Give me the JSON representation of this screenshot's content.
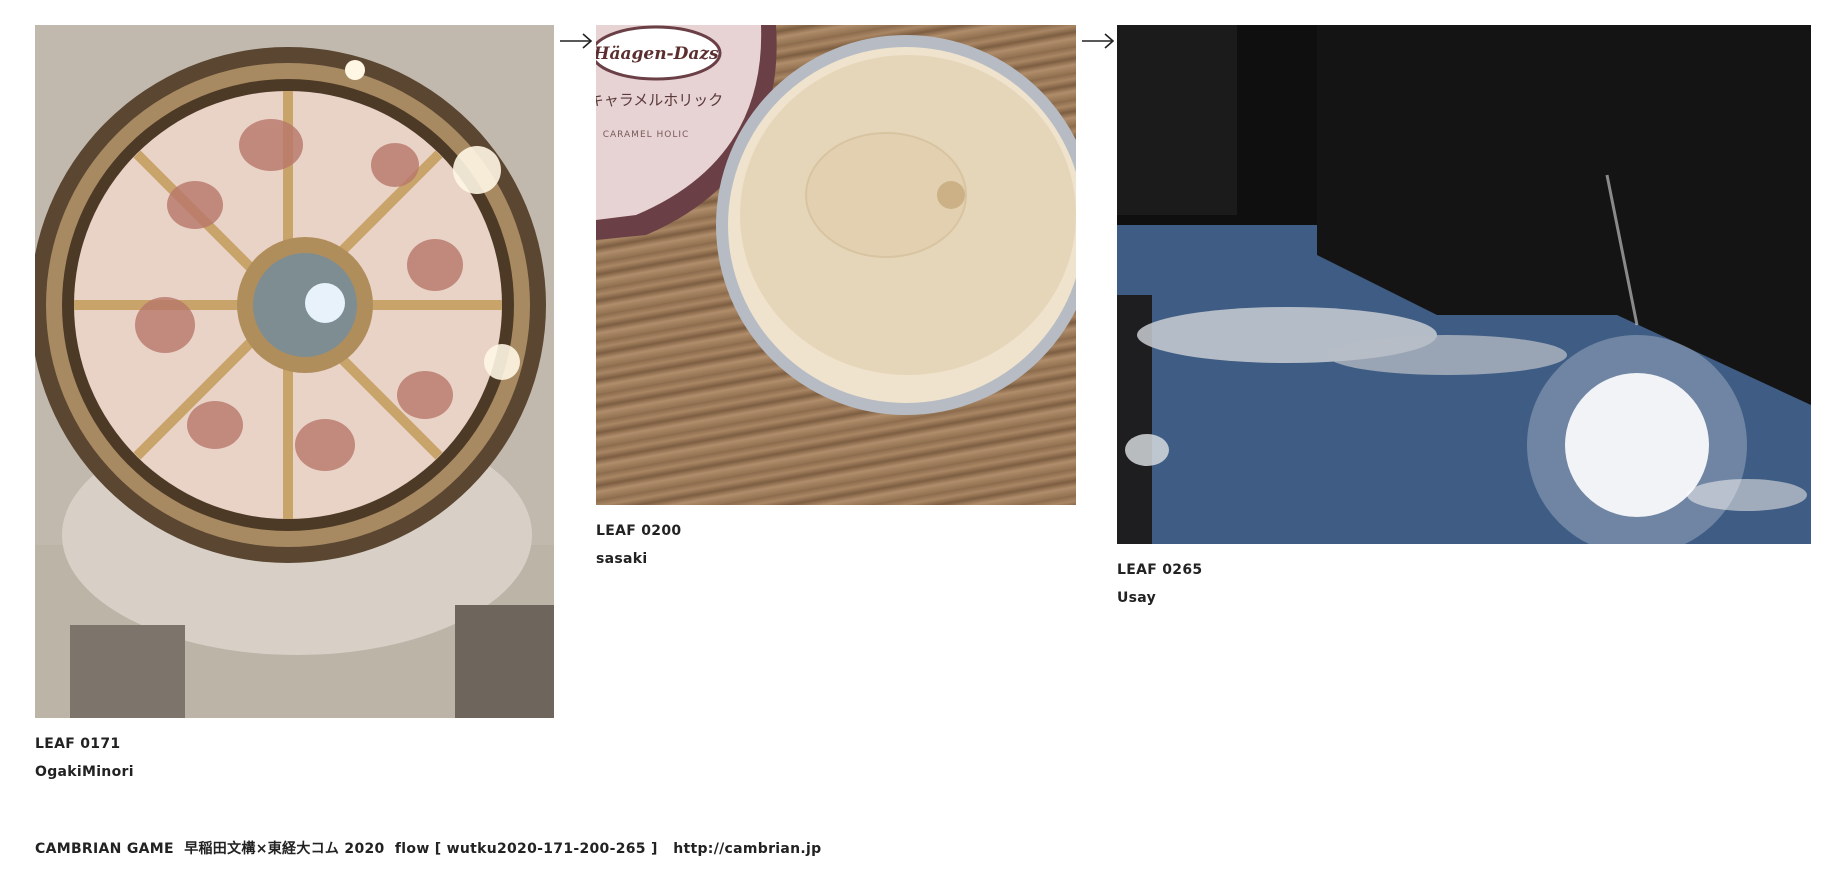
{
  "leaves": [
    {
      "label": "LEAF 0171",
      "author": "OgakiMinori"
    },
    {
      "label": "LEAF 0200",
      "author": "sasaki"
    },
    {
      "label": "LEAF 0265",
      "author": "Usay"
    }
  ],
  "photo_text": {
    "brand": "Häagen-Dazs",
    "flavor_jp": "キャラメルホリック",
    "flavor_en": "CARAMEL HOLIC"
  },
  "footer": {
    "text": "CAMBRIAN GAME  早稲田文構×東経大コム 2020  flow [ wutku2020-171-200-265 ]   ",
    "url": "http://cambrian.jp"
  },
  "icons": {
    "next": "arrow-right-icon"
  }
}
